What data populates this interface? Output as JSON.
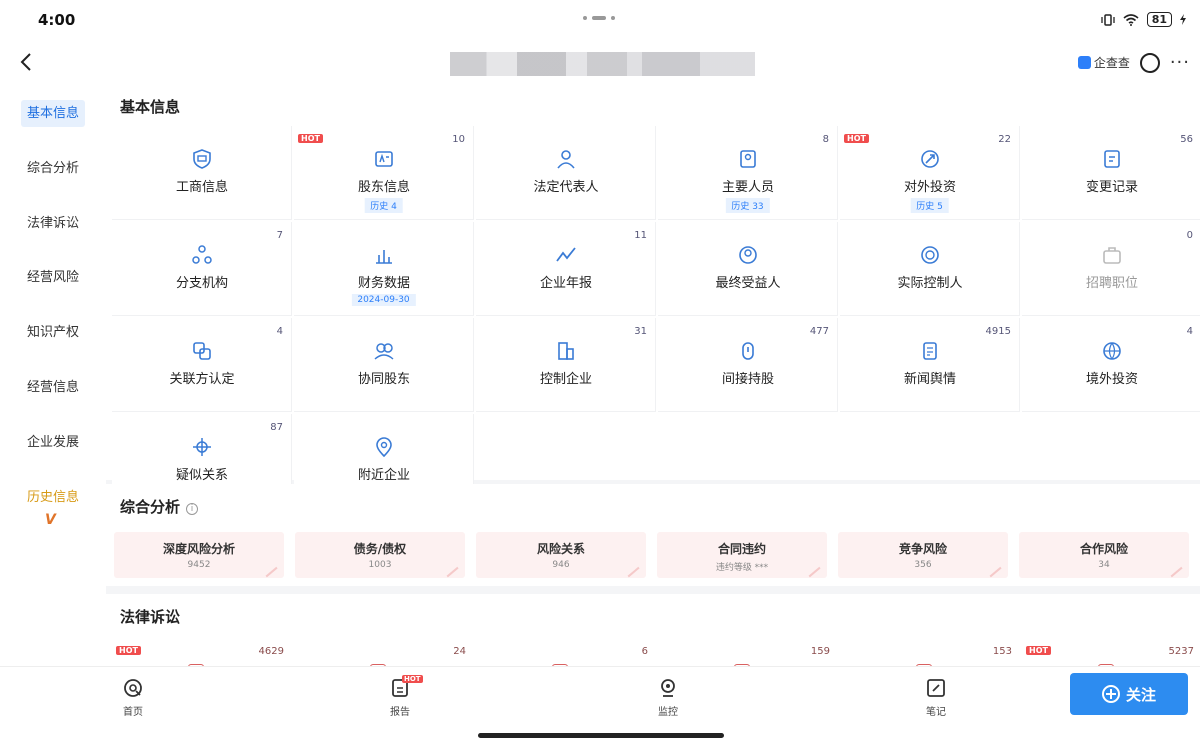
{
  "status": {
    "time": "4:00",
    "battery": "81"
  },
  "nav": {
    "brand": "企查查"
  },
  "sidebar": [
    "基本信息",
    "综合分析",
    "法律诉讼",
    "经营风险",
    "知识产权",
    "经营信息",
    "企业发展",
    "历史信息"
  ],
  "sidebar_badge": "V",
  "basic": {
    "title": "基本信息",
    "hot": "HOT",
    "items": [
      {
        "label": "工商信息",
        "count": "",
        "sub": ""
      },
      {
        "label": "股东信息",
        "count": "10",
        "sub": "历史 4"
      },
      {
        "label": "法定代表人",
        "count": "",
        "sub": ""
      },
      {
        "label": "主要人员",
        "count": "8",
        "sub": "历史 33"
      },
      {
        "label": "对外投资",
        "count": "22",
        "sub": "历史 5"
      },
      {
        "label": "变更记录",
        "count": "56",
        "sub": ""
      },
      {
        "label": "分支机构",
        "count": "7",
        "sub": ""
      },
      {
        "label": "财务数据",
        "count": "",
        "sub": "2024-09-30"
      },
      {
        "label": "企业年报",
        "count": "11",
        "sub": ""
      },
      {
        "label": "最终受益人",
        "count": "",
        "sub": ""
      },
      {
        "label": "实际控制人",
        "count": "",
        "sub": ""
      },
      {
        "label": "招聘职位",
        "count": "0",
        "sub": ""
      },
      {
        "label": "关联方认定",
        "count": "4",
        "sub": ""
      },
      {
        "label": "协同股东",
        "count": "",
        "sub": ""
      },
      {
        "label": "控制企业",
        "count": "31",
        "sub": ""
      },
      {
        "label": "间接持股",
        "count": "477",
        "sub": ""
      },
      {
        "label": "新闻舆情",
        "count": "4915",
        "sub": ""
      },
      {
        "label": "境外投资",
        "count": "4",
        "sub": ""
      },
      {
        "label": "疑似关系",
        "count": "87",
        "sub": ""
      },
      {
        "label": "附近企业",
        "count": "",
        "sub": ""
      }
    ]
  },
  "analysis": {
    "title": "综合分析",
    "info": "i",
    "cards": [
      {
        "title": "深度风险分析",
        "value": "9452"
      },
      {
        "title": "债务/债权",
        "value": "1003"
      },
      {
        "title": "风险关系",
        "value": "946"
      },
      {
        "title": "合同违约",
        "value": "违约等级 ***"
      },
      {
        "title": "竞争风险",
        "value": "356"
      },
      {
        "title": "合作风险",
        "value": "34"
      }
    ]
  },
  "law": {
    "title": "法律诉讼",
    "hot": "HOT",
    "counts": [
      "4629",
      "24",
      "6",
      "159",
      "153",
      "5237"
    ]
  },
  "tabbar": {
    "items": [
      "首页",
      "报告",
      "监控",
      "笔记"
    ],
    "hot": "HOT",
    "follow": "关注"
  },
  "colors": {
    "accent": "#2d8cf0",
    "hot": "#f04d4d",
    "history": "#d79a16"
  }
}
